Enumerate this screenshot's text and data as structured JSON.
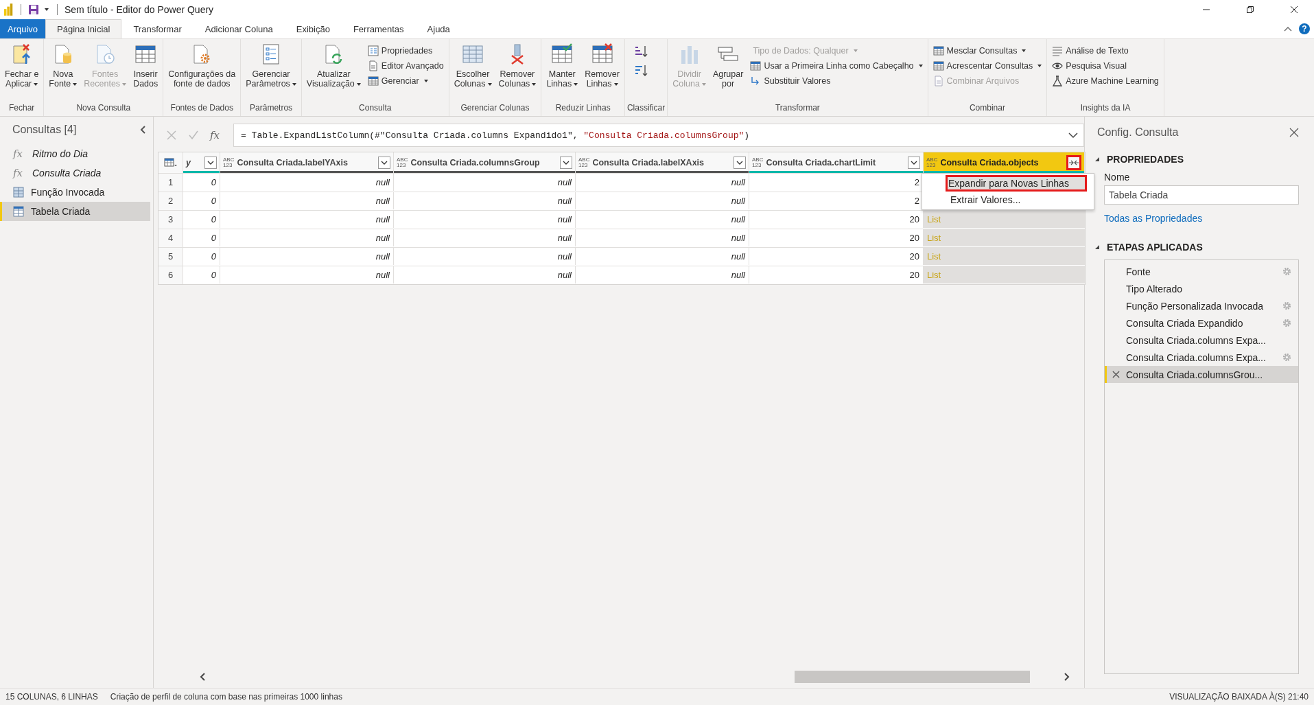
{
  "title_bar": {
    "title": "Sem título - Editor do Power Query"
  },
  "menu_tabs": [
    {
      "label": "Arquivo",
      "kind": "file",
      "selected": false
    },
    {
      "label": "Página Inicial",
      "kind": "tab",
      "selected": true
    },
    {
      "label": "Transformar",
      "kind": "tab",
      "selected": false
    },
    {
      "label": "Adicionar Coluna",
      "kind": "tab",
      "selected": false
    },
    {
      "label": "Exibição",
      "kind": "tab",
      "selected": false
    },
    {
      "label": "Ferramentas",
      "kind": "tab",
      "selected": false
    },
    {
      "label": "Ajuda",
      "kind": "tab",
      "selected": false
    }
  ],
  "help": "?",
  "ribbon": {
    "groups": [
      {
        "label": "Fechar",
        "items": [
          {
            "kind": "large",
            "lines": [
              "Fechar e",
              "Aplicar"
            ],
            "dropdown": true,
            "disabled": false
          }
        ]
      },
      {
        "label": "Nova Consulta",
        "items": [
          {
            "kind": "large",
            "lines": [
              "Nova",
              "Fonte"
            ],
            "dropdown": true,
            "disabled": false
          },
          {
            "kind": "large",
            "lines": [
              "Fontes",
              "Recentes"
            ],
            "dropdown": true,
            "disabled": true
          },
          {
            "kind": "large",
            "lines": [
              "Inserir",
              "Dados"
            ],
            "dropdown": false,
            "disabled": false
          }
        ]
      },
      {
        "label": "Fontes de Dados",
        "items": [
          {
            "kind": "large",
            "lines": [
              "Configurações da",
              "fonte de dados"
            ],
            "dropdown": false,
            "disabled": false
          }
        ]
      },
      {
        "label": "Parâmetros",
        "items": [
          {
            "kind": "large",
            "lines": [
              "Gerenciar",
              "Parâmetros"
            ],
            "dropdown": true,
            "disabled": false
          }
        ]
      },
      {
        "label": "Consulta",
        "items": [
          {
            "kind": "large",
            "lines": [
              "Atualizar",
              "Visualização"
            ],
            "dropdown": true,
            "disabled": false
          },
          {
            "kind": "column",
            "items": [
              {
                "label": "Propriedades",
                "dropdown": false,
                "disabled": false
              },
              {
                "label": "Editor Avançado",
                "dropdown": false,
                "disabled": false
              },
              {
                "label": "Gerenciar",
                "dropdown": true,
                "disabled": false
              }
            ]
          }
        ]
      },
      {
        "label": "Gerenciar Colunas",
        "items": [
          {
            "kind": "large",
            "lines": [
              "Escolher",
              "Colunas"
            ],
            "dropdown": true,
            "disabled": false
          },
          {
            "kind": "large",
            "lines": [
              "Remover",
              "Colunas"
            ],
            "dropdown": true,
            "disabled": false
          }
        ]
      },
      {
        "label": "Reduzir Linhas",
        "items": [
          {
            "kind": "large",
            "lines": [
              "Manter",
              "Linhas"
            ],
            "dropdown": true,
            "disabled": false
          },
          {
            "kind": "large",
            "lines": [
              "Remover",
              "Linhas"
            ],
            "dropdown": true,
            "disabled": false
          }
        ]
      },
      {
        "label": "Classificar",
        "items": [
          {
            "kind": "sort"
          }
        ]
      },
      {
        "label": "Transformar",
        "items": [
          {
            "kind": "large",
            "lines": [
              "Dividir",
              "Coluna"
            ],
            "dropdown": true,
            "disabled": true
          },
          {
            "kind": "large",
            "lines": [
              "Agrupar",
              "por"
            ],
            "dropdown": false,
            "disabled": false
          },
          {
            "kind": "column",
            "items": [
              {
                "label": "Tipo de Dados: Qualquer",
                "dropdown": true,
                "disabled": true
              },
              {
                "label": "Usar a Primeira Linha como Cabeçalho",
                "dropdown": true,
                "disabled": false
              },
              {
                "label": "Substituir Valores",
                "dropdown": false,
                "disabled": false
              }
            ]
          }
        ]
      },
      {
        "label": "Combinar",
        "items": [
          {
            "kind": "column",
            "items": [
              {
                "label": "Mesclar Consultas",
                "dropdown": true,
                "disabled": false
              },
              {
                "label": "Acrescentar Consultas",
                "dropdown": true,
                "disabled": false
              },
              {
                "label": "Combinar Arquivos",
                "dropdown": false,
                "disabled": true
              }
            ]
          }
        ]
      },
      {
        "label": "Insights da IA",
        "items": [
          {
            "kind": "column",
            "items": [
              {
                "label": "Análise de Texto",
                "dropdown": false,
                "disabled": false
              },
              {
                "label": "Pesquisa Visual",
                "dropdown": false,
                "disabled": false
              },
              {
                "label": "Azure Machine Learning",
                "dropdown": false,
                "disabled": false
              }
            ]
          }
        ]
      }
    ]
  },
  "queries": {
    "title": "Consultas [4]",
    "items": [
      {
        "label": "Ritmo do Dia",
        "kind": "function",
        "glyph": "fx",
        "selected": false
      },
      {
        "label": "Consulta Criada",
        "kind": "function",
        "glyph": "fx",
        "selected": false
      },
      {
        "label": "Função Invocada",
        "kind": "table",
        "selected": false
      },
      {
        "label": "Tabela Criada",
        "kind": "table",
        "selected": true
      }
    ]
  },
  "formula_bar": {
    "glyph": "fx",
    "parts": [
      {
        "text": "= Table.ExpandListColumn(#\"Consulta Criada.columns Expandido1\", ",
        "kind": "code"
      },
      {
        "text": "\"Consulta Criada.columnsGroup\"",
        "kind": "string"
      },
      {
        "text": ")",
        "kind": "code"
      }
    ]
  },
  "table": {
    "columns": [
      {
        "name": "y",
        "kind": "any",
        "complete": true,
        "selected": false
      },
      {
        "name": "Consulta Criada.labelYAxis",
        "type_lines": [
          "ABC",
          "123"
        ],
        "kind": "any",
        "complete": false,
        "selected": false
      },
      {
        "name": "Consulta Criada.columnsGroup",
        "type_lines": [
          "ABC",
          "123"
        ],
        "kind": "any",
        "complete": false,
        "selected": false
      },
      {
        "name": "Consulta Criada.labelXAxis",
        "type_lines": [
          "ABC",
          "123"
        ],
        "kind": "any",
        "complete": false,
        "selected": false
      },
      {
        "name": "Consulta Criada.chartLimit",
        "type_lines": [
          "ABC",
          "123"
        ],
        "kind": "number",
        "complete": true,
        "selected": false
      },
      {
        "name": "Consulta Criada.objects",
        "type_lines": [
          "ABC",
          "123"
        ],
        "kind": "list",
        "complete": true,
        "selected": true
      }
    ],
    "rows": [
      {
        "number": "1",
        "cells": [
          "0",
          "null",
          "null",
          "null",
          "2"
        ]
      },
      {
        "number": "2",
        "cells": [
          "0",
          "null",
          "null",
          "null",
          "2"
        ]
      },
      {
        "number": "3",
        "cells": [
          "0",
          "null",
          "null",
          "null",
          "20",
          "List"
        ]
      },
      {
        "number": "4",
        "cells": [
          "0",
          "null",
          "null",
          "null",
          "20",
          "List"
        ]
      },
      {
        "number": "5",
        "cells": [
          "0",
          "null",
          "null",
          "null",
          "20",
          "List"
        ]
      },
      {
        "number": "6",
        "cells": [
          "0",
          "null",
          "null",
          "null",
          "20",
          "List"
        ]
      }
    ],
    "expand_menu": {
      "items": [
        {
          "label": "Expandir para Novas Linhas",
          "highlighted": true
        },
        {
          "label": "Extrair Valores...",
          "highlighted": false
        }
      ]
    }
  },
  "settings": {
    "title": "Config. Consulta",
    "properties": {
      "heading": "PROPRIEDADES",
      "name_label": "Nome",
      "name_value": "Tabela Criada",
      "link": "Todas as Propriedades"
    },
    "steps_heading": "ETAPAS APLICADAS",
    "steps": [
      {
        "label": "Fonte",
        "settings": true,
        "selected": false
      },
      {
        "label": "Tipo Alterado",
        "settings": false,
        "selected": false
      },
      {
        "label": "Função Personalizada Invocada",
        "settings": true,
        "selected": false
      },
      {
        "label": "Consulta Criada Expandido",
        "settings": true,
        "selected": false
      },
      {
        "label": "Consulta Criada.columns Expa...",
        "settings": false,
        "selected": false
      },
      {
        "label": "Consulta Criada.columns Expa...",
        "settings": true,
        "selected": false
      },
      {
        "label": "Consulta Criada.columnsGrou...",
        "settings": false,
        "selected": true
      }
    ]
  },
  "status_bar": {
    "left": [
      "15 COLUNAS, 6 LINHAS",
      "Criação de perfil de coluna com base nas primeiras 1000 linhas"
    ],
    "right": "VISUALIZAÇÃO BAIXADA À(S) 21:40"
  }
}
